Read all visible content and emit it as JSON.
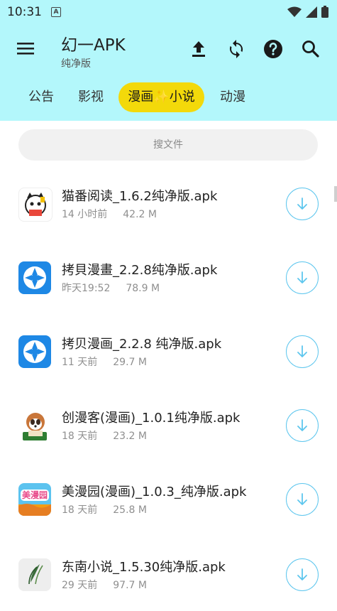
{
  "status": {
    "time": "10:31",
    "notification_letter": "A"
  },
  "app": {
    "title": "幻一APK",
    "subtitle": "纯净版"
  },
  "toolbar_icons": [
    "upload-icon",
    "sync-icon",
    "help-icon",
    "search-icon"
  ],
  "tabs": [
    {
      "label": "公告",
      "active": false
    },
    {
      "label": "影视",
      "active": false
    },
    {
      "label": "漫画✨小说",
      "active": true
    },
    {
      "label": "动漫",
      "active": false
    }
  ],
  "search": {
    "placeholder": "搜文件"
  },
  "files": [
    {
      "name": "猫番阅读_1.6.2纯净版.apk",
      "time": "14 小时前",
      "size": "42.2 M",
      "icon": "cat-reader-icon"
    },
    {
      "name": "拷貝漫畫_2.2.8纯净版.apk",
      "time": "昨天19:52",
      "size": "78.9 M",
      "icon": "copy-manga-icon"
    },
    {
      "name": "拷贝漫画_2.2.8 纯净版.apk",
      "time": "11 天前",
      "size": "29.7 M",
      "icon": "copy-manga-icon"
    },
    {
      "name": "创漫客(漫画)_1.0.1纯净版.apk",
      "time": "18 天前",
      "size": "23.2 M",
      "icon": "raccoon-icon"
    },
    {
      "name": "美漫园(漫画)_1.0.3_纯净版.apk",
      "time": "18 天前",
      "size": "25.8 M",
      "icon": "meimanyuan-icon"
    },
    {
      "name": "东南小说_1.5.30纯净版.apk",
      "time": "29 天前",
      "size": "97.7 M",
      "icon": "feather-icon"
    }
  ],
  "colors": {
    "header_bg": "#b3f7fb",
    "tab_active_bg": "#f3d90a",
    "download_accent": "#5dc6ee"
  },
  "logo_text": {
    "meimanyuan": "美漫园"
  }
}
